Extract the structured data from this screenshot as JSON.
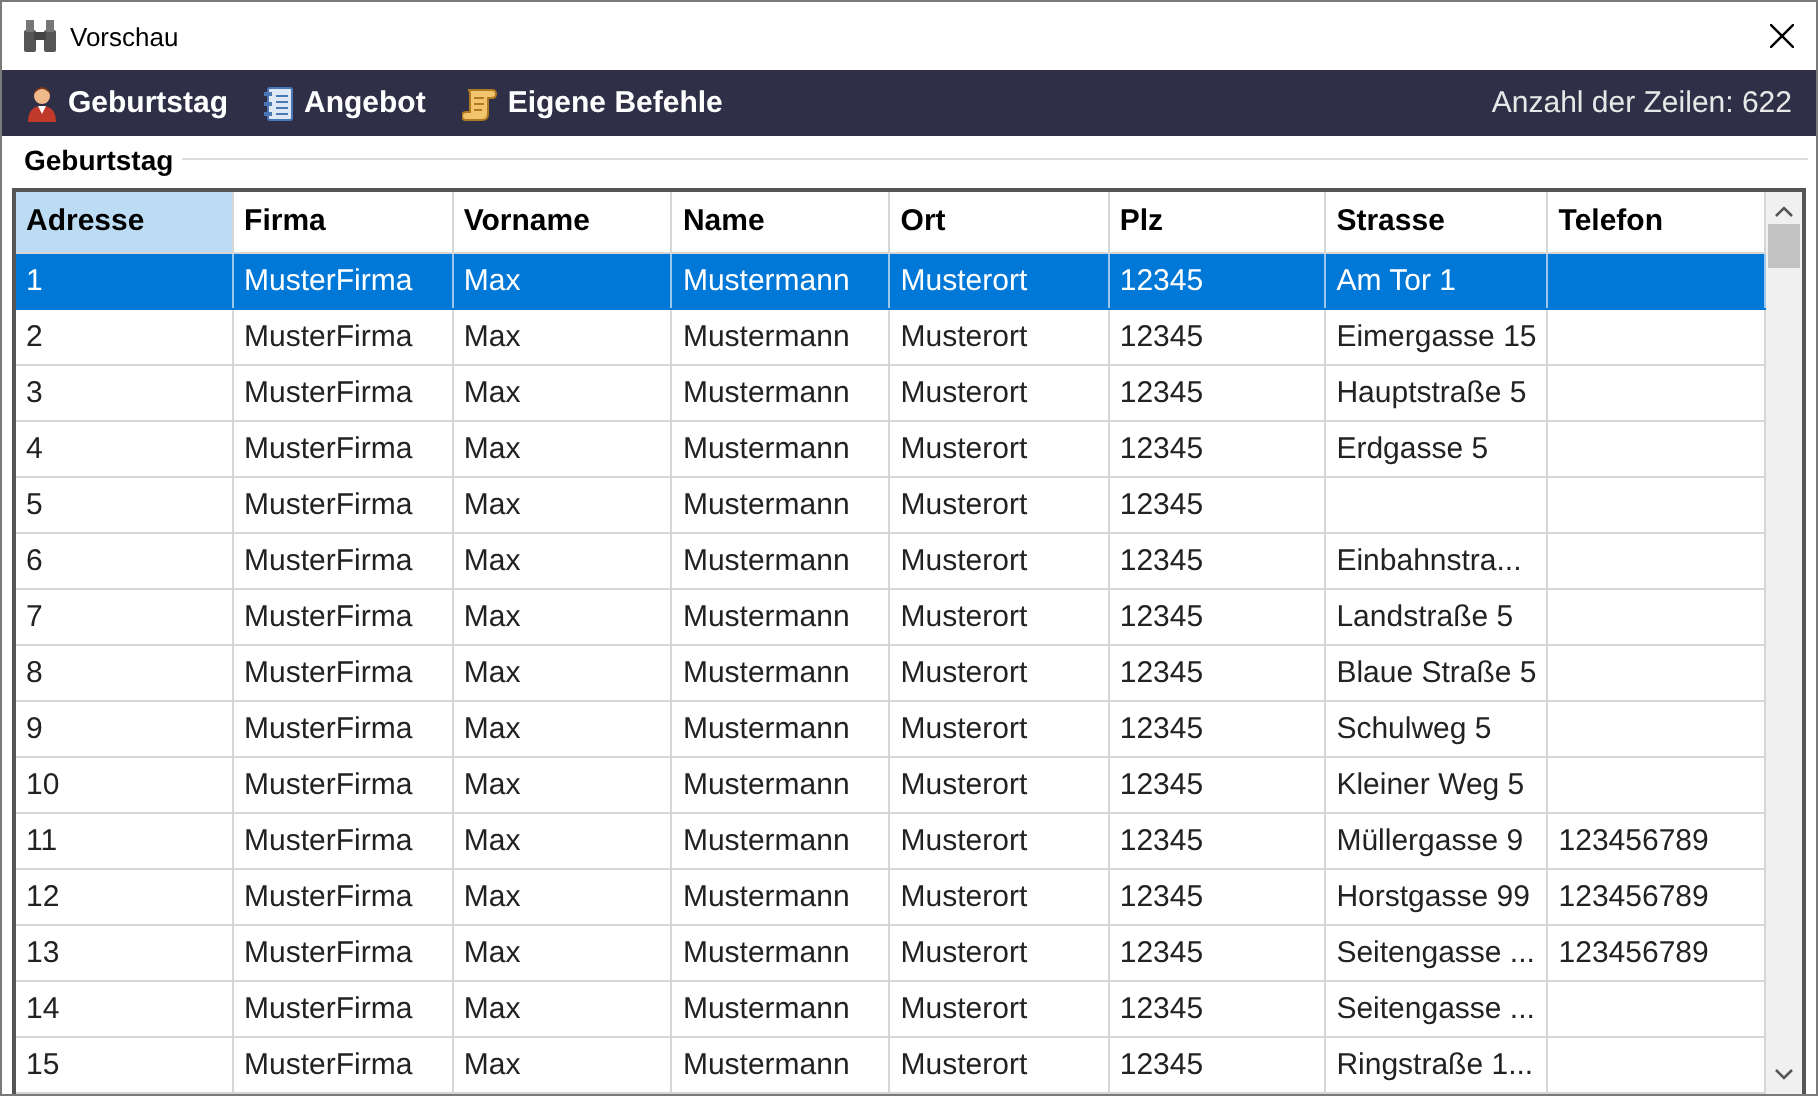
{
  "window": {
    "title": "Vorschau"
  },
  "toolbar": {
    "buttons": [
      {
        "label": "Geburtstag",
        "kind": "person"
      },
      {
        "label": "Angebot",
        "kind": "notebook"
      },
      {
        "label": "Eigene Befehle",
        "kind": "scroll"
      }
    ],
    "row_count": "Anzahl der Zeilen: 622"
  },
  "group": {
    "title": "Geburtstag"
  },
  "table": {
    "columns": [
      {
        "label": "Adresse",
        "selected": true
      },
      {
        "label": "Firma",
        "selected": false
      },
      {
        "label": "Vorname",
        "selected": false
      },
      {
        "label": "Name",
        "selected": false
      },
      {
        "label": "Ort",
        "selected": false
      },
      {
        "label": "Plz",
        "selected": false
      },
      {
        "label": "Strasse",
        "selected": false
      },
      {
        "label": "Telefon",
        "selected": false
      }
    ],
    "rows": [
      {
        "selected": true,
        "cells": [
          "1",
          "MusterFirma",
          "Max",
          "Mustermann",
          "Musterort",
          "12345",
          "Am Tor 1",
          ""
        ]
      },
      {
        "selected": false,
        "cells": [
          "2",
          "MusterFirma",
          "Max",
          "Mustermann",
          "Musterort",
          "12345",
          "Eimergasse 15",
          ""
        ]
      },
      {
        "selected": false,
        "cells": [
          "3",
          "MusterFirma",
          "Max",
          "Mustermann",
          "Musterort",
          "12345",
          "Hauptstraße 5",
          ""
        ]
      },
      {
        "selected": false,
        "cells": [
          "4",
          "MusterFirma",
          "Max",
          "Mustermann",
          "Musterort",
          "12345",
          "Erdgasse 5",
          ""
        ]
      },
      {
        "selected": false,
        "cells": [
          "5",
          "MusterFirma",
          "Max",
          "Mustermann",
          "Musterort",
          "12345",
          "",
          ""
        ]
      },
      {
        "selected": false,
        "cells": [
          "6",
          "MusterFirma",
          "Max",
          "Mustermann",
          "Musterort",
          "12345",
          "Einbahnstra...",
          ""
        ]
      },
      {
        "selected": false,
        "cells": [
          "7",
          "MusterFirma",
          "Max",
          "Mustermann",
          "Musterort",
          "12345",
          "Landstraße 5",
          ""
        ]
      },
      {
        "selected": false,
        "cells": [
          "8",
          "MusterFirma",
          "Max",
          "Mustermann",
          "Musterort",
          "12345",
          "Blaue Straße 5",
          ""
        ]
      },
      {
        "selected": false,
        "cells": [
          "9",
          "MusterFirma",
          "Max",
          "Mustermann",
          "Musterort",
          "12345",
          "Schulweg 5",
          ""
        ]
      },
      {
        "selected": false,
        "cells": [
          "10",
          "MusterFirma",
          "Max",
          "Mustermann",
          "Musterort",
          "12345",
          "Kleiner Weg 5",
          ""
        ]
      },
      {
        "selected": false,
        "cells": [
          "11",
          "MusterFirma",
          "Max",
          "Mustermann",
          "Musterort",
          "12345",
          "Müllergasse 9",
          "123456789"
        ]
      },
      {
        "selected": false,
        "cells": [
          "12",
          "MusterFirma",
          "Max",
          "Mustermann",
          "Musterort",
          "12345",
          "Horstgasse 99",
          "123456789"
        ]
      },
      {
        "selected": false,
        "cells": [
          "13",
          "MusterFirma",
          "Max",
          "Mustermann",
          "Musterort",
          "12345",
          "Seitengasse ...",
          "123456789"
        ]
      },
      {
        "selected": false,
        "cells": [
          "14",
          "MusterFirma",
          "Max",
          "Mustermann",
          "Musterort",
          "12345",
          "Seitengasse ...",
          ""
        ]
      },
      {
        "selected": false,
        "cells": [
          "15",
          "MusterFirma",
          "Max",
          "Mustermann",
          "Musterort",
          "12345",
          "Ringstraße 1...",
          ""
        ]
      }
    ]
  }
}
